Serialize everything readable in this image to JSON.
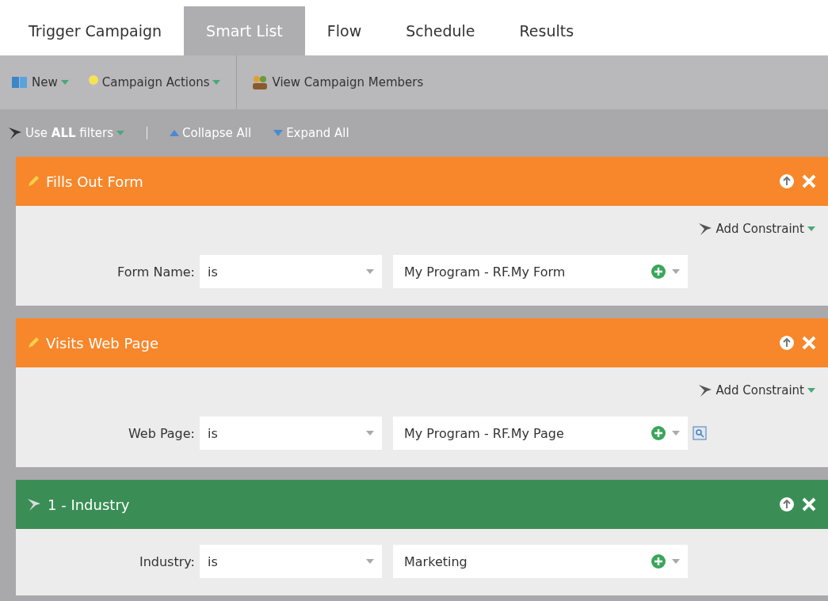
{
  "tabs": [
    {
      "label": "Trigger Campaign",
      "selected": false
    },
    {
      "label": "Smart List",
      "selected": true
    },
    {
      "label": "Flow",
      "selected": false
    },
    {
      "label": "Schedule",
      "selected": false
    },
    {
      "label": "Results",
      "selected": false
    }
  ],
  "toolbar": [
    {
      "label": "New",
      "kind": "menu"
    },
    {
      "label": "Campaign Actions",
      "kind": "menu"
    },
    {
      "label": "View Campaign Members",
      "kind": "action"
    }
  ],
  "filter_bar": {
    "rule": "Use **ALL** filters",
    "collapse": "Collapse All",
    "expand": "Expand All"
  },
  "filters": [
    {
      "title": "Fills Out Form",
      "kind": "trigger",
      "add_constraint": "Add Constraint",
      "field": "Form Name:",
      "operator": "is",
      "value": "My Program - RF.My Form",
      "lookup": false
    },
    {
      "title": "Visits Web Page",
      "kind": "trigger",
      "add_constraint": "Add Constraint",
      "field": "Web Page:",
      "operator": "is",
      "value": "My Program - RF.My Page",
      "lookup": true
    },
    {
      "title": "1 - Industry",
      "kind": "filter",
      "field": "Industry:",
      "operator": "is",
      "value": "Marketing",
      "lookup": false
    }
  ]
}
